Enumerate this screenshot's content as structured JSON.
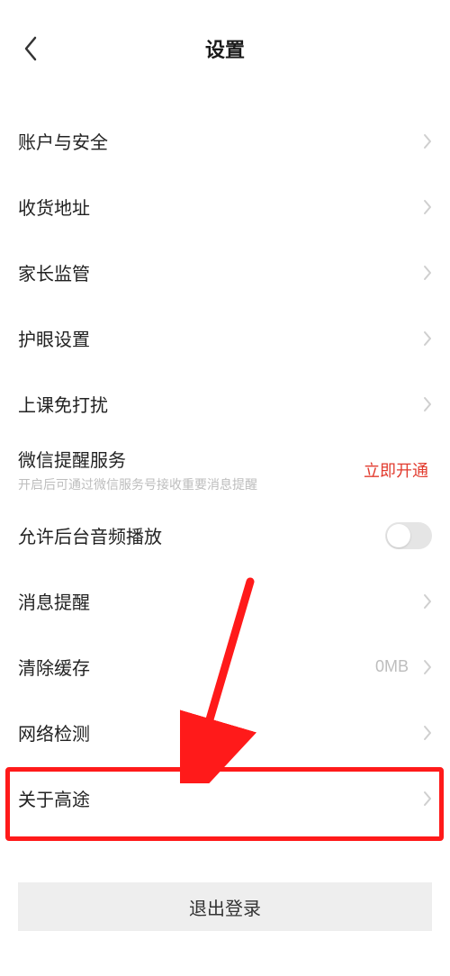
{
  "header": {
    "title": "设置"
  },
  "items": [
    {
      "label": "账户与安全"
    },
    {
      "label": "收货地址"
    },
    {
      "label": "家长监管"
    },
    {
      "label": "护眼设置"
    },
    {
      "label": "上课免打扰"
    },
    {
      "label": "微信提醒服务",
      "sub": "开启后可通过微信服务号接收重要消息提醒",
      "action": "立即开通"
    },
    {
      "label": "允许后台音频播放"
    },
    {
      "label": "消息提醒"
    },
    {
      "label": "清除缓存",
      "value": "0MB"
    },
    {
      "label": "网络检测"
    },
    {
      "label": "关于高途"
    }
  ],
  "logout": {
    "label": "退出登录"
  }
}
